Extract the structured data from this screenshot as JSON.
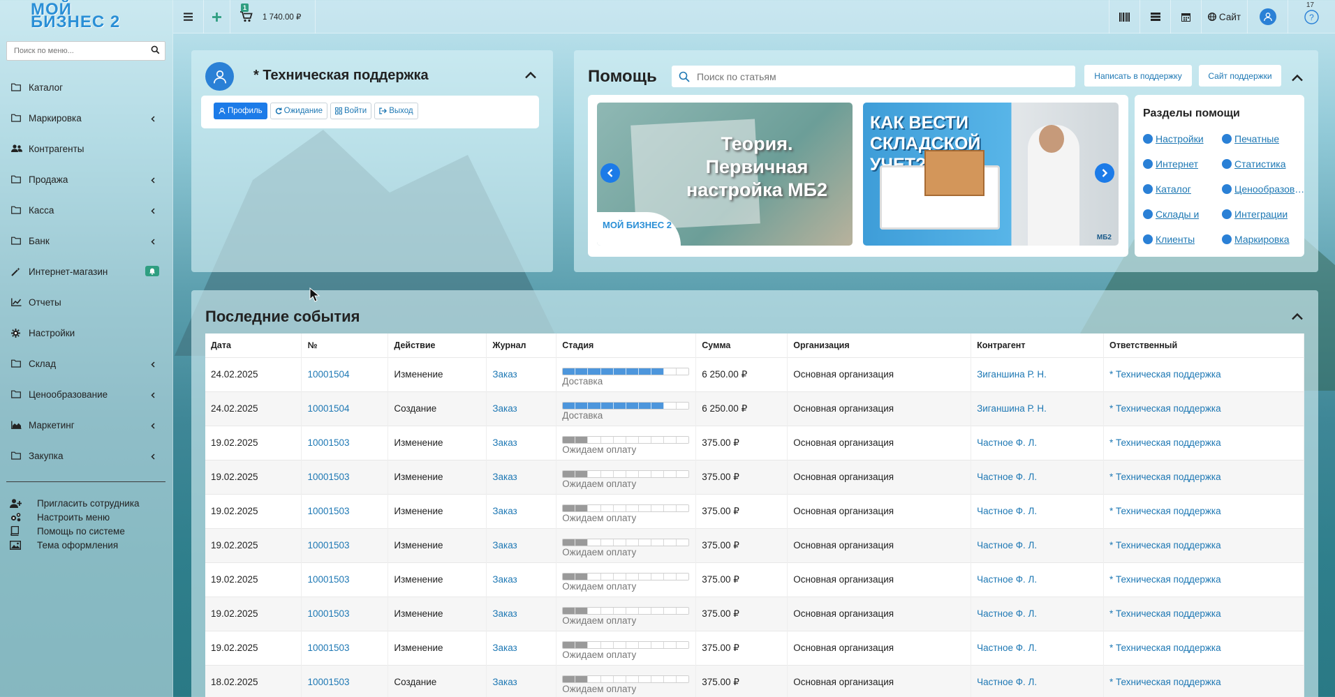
{
  "logo": {
    "line1": "МОЙ",
    "line2": "БИЗНЕС 2"
  },
  "sidebar": {
    "search_placeholder": "Поиск по меню...",
    "items": [
      {
        "label": "Каталог",
        "icon": "folder-icon",
        "has_children": false
      },
      {
        "label": "Маркировка",
        "icon": "folder-icon",
        "has_children": true
      },
      {
        "label": "Контрагенты",
        "icon": "users-icon",
        "has_children": false
      },
      {
        "label": "Продажа",
        "icon": "folder-icon",
        "has_children": true
      },
      {
        "label": "Касса",
        "icon": "folder-icon",
        "has_children": true
      },
      {
        "label": "Банк",
        "icon": "folder-icon",
        "has_children": true
      },
      {
        "label": "Интернет-магазин",
        "icon": "wand-icon",
        "has_children": false,
        "badge": "bell-icon"
      },
      {
        "label": "Отчеты",
        "icon": "line-chart-icon",
        "has_children": false
      },
      {
        "label": "Настройки",
        "icon": "gear-icon",
        "has_children": false
      },
      {
        "label": "Склад",
        "icon": "folder-icon",
        "has_children": true
      },
      {
        "label": "Ценообразование",
        "icon": "folder-icon",
        "has_children": true
      },
      {
        "label": "Маркетинг",
        "icon": "area-chart-icon",
        "has_children": true
      },
      {
        "label": "Закупка",
        "icon": "folder-icon",
        "has_children": true
      }
    ],
    "bottom": [
      {
        "label": "Пригласить сотрудника",
        "icon": "user-plus-icon"
      },
      {
        "label": "Настроить меню",
        "icon": "gears-icon"
      },
      {
        "label": "Помощь по системе",
        "icon": "book-icon"
      },
      {
        "label": "Тема оформления",
        "icon": "image-icon"
      }
    ]
  },
  "topbar": {
    "cart_count": "1",
    "cart_sum": "1 740.00 ₽",
    "site_label": "Сайт",
    "notifications": "17"
  },
  "profile": {
    "title": "* Техническая поддержка",
    "buttons": [
      "Профиль",
      "Ожидание",
      "Войти",
      "Выход"
    ]
  },
  "help": {
    "title": "Помощь",
    "search_placeholder": "Поиск по статьям",
    "write_support": "Написать в поддержку",
    "support_site": "Сайт поддержки",
    "slides": [
      {
        "text": "Теория. Первичная настройка МБ2",
        "logo": "МОЙ БИЗНЕС 2"
      },
      {
        "text": "КАК ВЕСТИ СКЛАДСКОЙ УЧЕТ?",
        "logo": "МБ2"
      }
    ],
    "sections_title": "Разделы помощи",
    "sections": [
      "Настройки",
      "Печатные",
      "Интернет",
      "Статистика",
      "Каталог",
      "Ценообразование",
      "Склады и",
      "Интеграции",
      "Клиенты",
      "Маркировка"
    ]
  },
  "events": {
    "title": "Последние события",
    "columns": [
      "Дата",
      "№",
      "Действие",
      "Журнал",
      "Стадия",
      "Сумма",
      "Организация",
      "Контрагент",
      "Ответственный"
    ],
    "rows": [
      {
        "date": "24.02.2025",
        "num": "10001504",
        "action": "Изменение",
        "journal": "Заказ",
        "stage": "Доставка",
        "stage_progress": 8,
        "stage_color": "blue",
        "sum": "6 250.00 ₽",
        "org": "Основная организация",
        "counterparty": "Зиганшина Р. Н.",
        "responsible": "* Техническая поддержка"
      },
      {
        "date": "24.02.2025",
        "num": "10001504",
        "action": "Создание",
        "journal": "Заказ",
        "stage": "Доставка",
        "stage_progress": 8,
        "stage_color": "blue",
        "sum": "6 250.00 ₽",
        "org": "Основная организация",
        "counterparty": "Зиганшина Р. Н.",
        "responsible": "* Техническая поддержка"
      },
      {
        "date": "19.02.2025",
        "num": "10001503",
        "action": "Изменение",
        "journal": "Заказ",
        "stage": "Ожидаем оплату",
        "stage_progress": 2,
        "stage_color": "gray",
        "sum": "375.00 ₽",
        "org": "Основная организация",
        "counterparty": "Частное Ф. Л.",
        "responsible": "* Техническая поддержка"
      },
      {
        "date": "19.02.2025",
        "num": "10001503",
        "action": "Изменение",
        "journal": "Заказ",
        "stage": "Ожидаем оплату",
        "stage_progress": 2,
        "stage_color": "gray",
        "sum": "375.00 ₽",
        "org": "Основная организация",
        "counterparty": "Частное Ф. Л.",
        "responsible": "* Техническая поддержка"
      },
      {
        "date": "19.02.2025",
        "num": "10001503",
        "action": "Изменение",
        "journal": "Заказ",
        "stage": "Ожидаем оплату",
        "stage_progress": 2,
        "stage_color": "gray",
        "sum": "375.00 ₽",
        "org": "Основная организация",
        "counterparty": "Частное Ф. Л.",
        "responsible": "* Техническая поддержка"
      },
      {
        "date": "19.02.2025",
        "num": "10001503",
        "action": "Изменение",
        "journal": "Заказ",
        "stage": "Ожидаем оплату",
        "stage_progress": 2,
        "stage_color": "gray",
        "sum": "375.00 ₽",
        "org": "Основная организация",
        "counterparty": "Частное Ф. Л.",
        "responsible": "* Техническая поддержка"
      },
      {
        "date": "19.02.2025",
        "num": "10001503",
        "action": "Изменение",
        "journal": "Заказ",
        "stage": "Ожидаем оплату",
        "stage_progress": 2,
        "stage_color": "gray",
        "sum": "375.00 ₽",
        "org": "Основная организация",
        "counterparty": "Частное Ф. Л.",
        "responsible": "* Техническая поддержка"
      },
      {
        "date": "19.02.2025",
        "num": "10001503",
        "action": "Изменение",
        "journal": "Заказ",
        "stage": "Ожидаем оплату",
        "stage_progress": 2,
        "stage_color": "gray",
        "sum": "375.00 ₽",
        "org": "Основная организация",
        "counterparty": "Частное Ф. Л.",
        "responsible": "* Техническая поддержка"
      },
      {
        "date": "19.02.2025",
        "num": "10001503",
        "action": "Изменение",
        "journal": "Заказ",
        "stage": "Ожидаем оплату",
        "stage_progress": 2,
        "stage_color": "gray",
        "sum": "375.00 ₽",
        "org": "Основная организация",
        "counterparty": "Частное Ф. Л.",
        "responsible": "* Техническая поддержка"
      },
      {
        "date": "18.02.2025",
        "num": "10001503",
        "action": "Создание",
        "journal": "Заказ",
        "stage": "Ожидаем оплату",
        "stage_progress": 2,
        "stage_color": "gray",
        "sum": "375.00 ₽",
        "org": "Основная организация",
        "counterparty": "Частное Ф. Л.",
        "responsible": "* Техническая поддержка"
      }
    ]
  }
}
